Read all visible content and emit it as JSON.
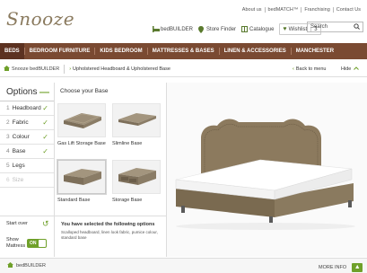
{
  "brand": {
    "logo": "Snooze"
  },
  "toplinks": [
    "About us",
    "bedMATCH™",
    "Franchising",
    "Contact Us"
  ],
  "tools": {
    "bedbuilder": "bedBUILDER",
    "store_finder": "Store Finder",
    "catalogue": "Catalogue",
    "wishlist": "Wishlist",
    "wishlist_count": "3"
  },
  "search": {
    "placeholder": "Search"
  },
  "nav": [
    "BEDS",
    "BEDROOM FURNITURE",
    "KIDS BEDROOM",
    "MATTRESSES & BASES",
    "LINEN & ACCESSORIES",
    "MANCHESTER"
  ],
  "breadcrumb": {
    "home": "Snooze bedBUILDER",
    "title": "Upholstered Headboard & Upholstered Base",
    "back": "Back to menu",
    "hide": "Hide"
  },
  "options": {
    "title": "Options",
    "items": [
      {
        "num": "1",
        "label": "Headboard",
        "done": true
      },
      {
        "num": "2",
        "label": "Fabric",
        "done": true
      },
      {
        "num": "3",
        "label": "Colour",
        "done": true
      },
      {
        "num": "4",
        "label": "Base",
        "done": true
      },
      {
        "num": "5",
        "label": "Legs",
        "done": false
      },
      {
        "num": "6",
        "label": "Size",
        "done": false
      }
    ]
  },
  "base_choice": {
    "title": "Choose your Base",
    "tiles": [
      {
        "label": "Gas Lift Storage Base"
      },
      {
        "label": "Slimline Base"
      },
      {
        "label": "Standard Base"
      },
      {
        "label": "Storage Base"
      }
    ],
    "selected": "Standard Base"
  },
  "controls": {
    "start_over": "Start over",
    "show_mattress_1": "Show",
    "show_mattress_2": "Mattress",
    "toggle": "ON"
  },
  "selection_summary": {
    "title": "You have selected the following options",
    "desc": "Scalloped headboard, linen look fabric, pumice colour, standard base"
  },
  "footer": {
    "left": "bedBUILDER",
    "right": "MORE INFO"
  },
  "colors": {
    "nav": "#7a4a32",
    "accent": "#6fa02a",
    "fabric": "#8c7a5e"
  }
}
